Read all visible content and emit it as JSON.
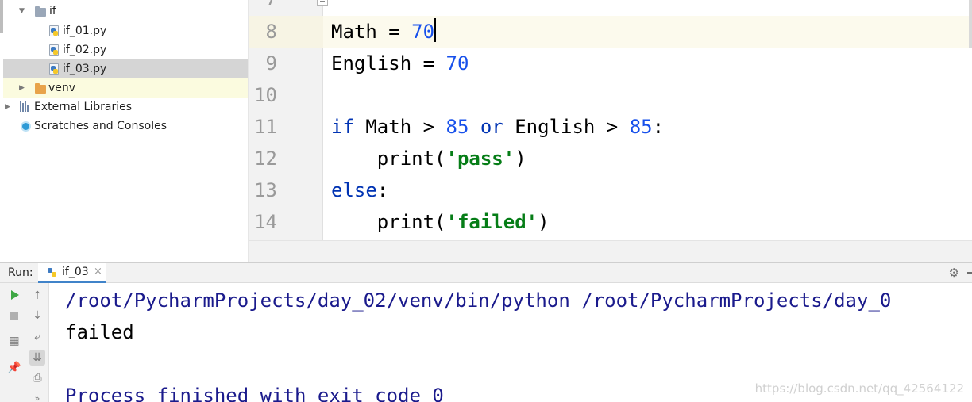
{
  "project_tree": {
    "items": [
      {
        "label": "if",
        "type": "folder"
      },
      {
        "label": "if_01.py",
        "type": "file"
      },
      {
        "label": "if_02.py",
        "type": "file"
      },
      {
        "label": "if_03.py",
        "type": "file",
        "selected": true
      },
      {
        "label": "venv",
        "type": "folder"
      },
      {
        "label": "External Libraries",
        "type": "libraries"
      },
      {
        "label": "Scratches and Consoles",
        "type": "scratches"
      }
    ]
  },
  "editor": {
    "partial_top_line_number": "7",
    "line_numbers": [
      "8",
      "9",
      "10",
      "11",
      "12",
      "13",
      "14"
    ],
    "lines": {
      "l8": {
        "name": "Math",
        "op": " = ",
        "value": "70"
      },
      "l9": {
        "name": "English",
        "op": " = ",
        "value": "70"
      },
      "l11": {
        "kw_if": "if",
        "a": " Math > ",
        "n1": "85",
        "kw_or": "or",
        "b": " English > ",
        "n2": "85",
        "colon": ":"
      },
      "l12": {
        "indent": "    ",
        "fn": "print(",
        "str": "'pass'",
        "close": ")"
      },
      "l13": {
        "kw_else": "else",
        "colon": ":"
      },
      "l14": {
        "indent": "    ",
        "fn": "print(",
        "str": "'failed'",
        "close": ")"
      }
    },
    "colors": {
      "keyword": "#0033b3",
      "number": "#1750eb",
      "string": "#067d17"
    }
  },
  "run_panel": {
    "label": "Run:",
    "tab_label": "if_03",
    "close_glyph": "×",
    "console": {
      "command": "/root/PycharmProjects/day_02/venv/bin/python /root/PycharmProjects/day_0",
      "output": "failed",
      "process": "Process finished with exit code 0"
    }
  },
  "watermark": "https://blog.csdn.net/qq_42564122"
}
